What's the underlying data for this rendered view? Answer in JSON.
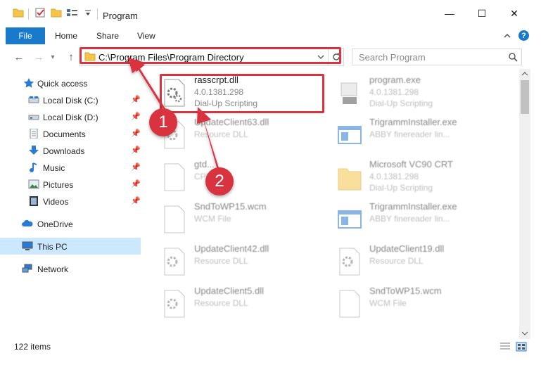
{
  "window": {
    "title": "Program",
    "minimize": "—",
    "maximize": "☐",
    "close": "✕"
  },
  "ribbon": {
    "file": "File",
    "tabs": [
      "Home",
      "Share",
      "View"
    ],
    "help": "?"
  },
  "address": {
    "path": "C:\\Program Files\\Program Directory",
    "search_placeholder": "Search Program"
  },
  "sidebar": {
    "items": [
      {
        "label": "Quick access",
        "icon": "star-icon",
        "pinned": false
      },
      {
        "label": "Local Disk (C:)",
        "icon": "drive-icon",
        "pinned": true
      },
      {
        "label": "Local Disk (D:)",
        "icon": "drive-icon",
        "pinned": true
      },
      {
        "label": "Documents",
        "icon": "documents-icon",
        "pinned": true
      },
      {
        "label": "Downloads",
        "icon": "downloads-icon",
        "pinned": true
      },
      {
        "label": "Music",
        "icon": "music-icon",
        "pinned": true
      },
      {
        "label": "Pictures",
        "icon": "pictures-icon",
        "pinned": true
      },
      {
        "label": "Videos",
        "icon": "videos-icon",
        "pinned": true
      },
      {
        "label": "OneDrive",
        "icon": "onedrive-icon",
        "pinned": false
      },
      {
        "label": "This PC",
        "icon": "pc-icon",
        "pinned": false,
        "selected": true
      },
      {
        "label": "Network",
        "icon": "network-icon",
        "pinned": false
      }
    ]
  },
  "files": [
    {
      "name": "rasscrpt.dll",
      "line1": "4.0.1381.298",
      "line2": "Dial-Up Scripting",
      "icon": "dll-gear-icon",
      "highlight": true
    },
    {
      "name": "program.exe",
      "line1": "4.0.1381.298",
      "line2": "Dial-Up Scripting",
      "icon": "exe-icon"
    },
    {
      "name": "UpdateClient63.dll",
      "line1": "Resource DLL",
      "line2": "",
      "icon": "dll-gear-icon"
    },
    {
      "name": "TrigrammInstaller.exe",
      "line1": "ABBY finereader lin...",
      "line2": "",
      "icon": "window-app-icon"
    },
    {
      "name": "gtd...",
      "line1": "CPL...",
      "line2": "",
      "icon": "blank-file-icon"
    },
    {
      "name": "Microsoft VC90 CRT",
      "line1": "4.0.1381.298",
      "line2": "Dial-Up Scripting",
      "icon": "folder-icon"
    },
    {
      "name": "SndToWP15.wcm",
      "line1": "WCM File",
      "line2": "",
      "icon": "blank-file-icon"
    },
    {
      "name": "TrigrammInstaller.exe",
      "line1": "ABBY finereader lin...",
      "line2": "",
      "icon": "window-app-icon"
    },
    {
      "name": "UpdateClient42.dll",
      "line1": "Resource DLL",
      "line2": "",
      "icon": "dll-gear-icon"
    },
    {
      "name": "UpdateClient19.dll",
      "line1": "Resource DLL",
      "line2": "",
      "icon": "dll-gear-icon"
    },
    {
      "name": "UpdateClient5.dll",
      "line1": "Resource DLL",
      "line2": "",
      "icon": "dll-gear-icon"
    },
    {
      "name": "SndToWP15.wcm",
      "line1": "WCM File",
      "line2": "",
      "icon": "blank-file-icon"
    }
  ],
  "status": {
    "item_count": "122 items"
  },
  "annotations": {
    "step1": "1",
    "step2": "2"
  },
  "colors": {
    "accent": "#1979ca",
    "highlight_red": "#d9333f",
    "selected_bg": "#cce8ff"
  }
}
